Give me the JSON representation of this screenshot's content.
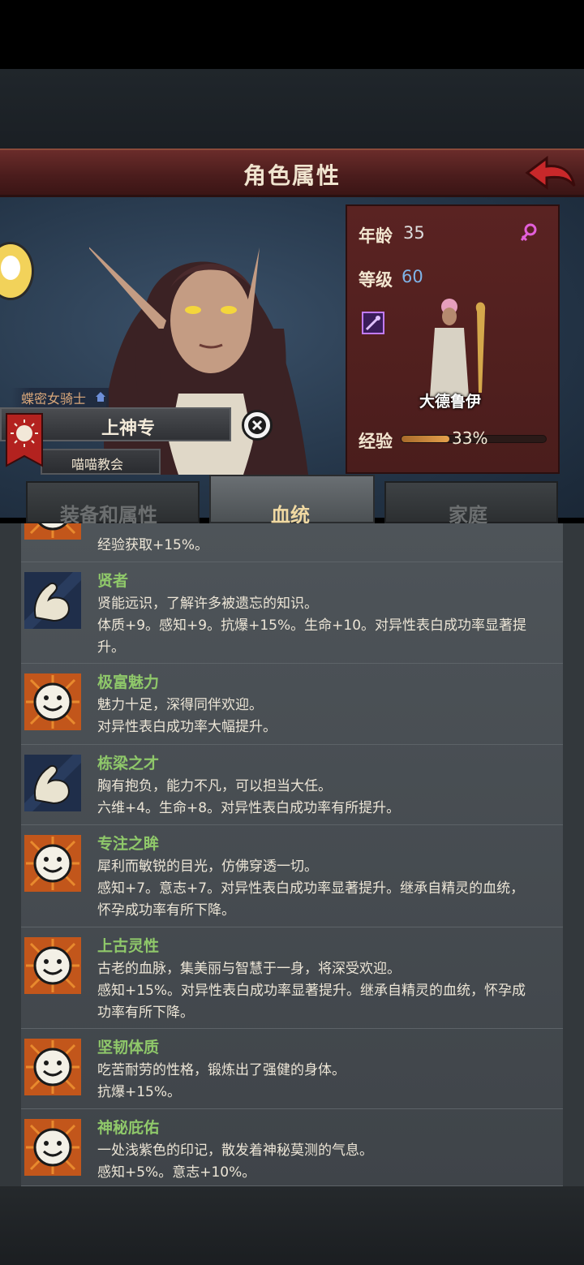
{
  "header": {
    "title": "角色属性"
  },
  "character": {
    "title": "蝶密女骑士",
    "name": "上神专",
    "church": "喵喵教会",
    "class_name": "大德鲁伊"
  },
  "stats": {
    "age_label": "年龄",
    "age_value": "35",
    "level_label": "等级",
    "level_value": "60",
    "exp_label": "经验",
    "exp_percent": "33%",
    "exp_fraction": 0.33
  },
  "tabs": [
    {
      "label": "装备和属性",
      "active": false
    },
    {
      "label": "血统",
      "active": true
    },
    {
      "label": "家庭",
      "active": false
    }
  ],
  "traits": [
    {
      "icon": "smile-icon",
      "name": "",
      "lines": [
        "经验获取+15%。"
      ]
    },
    {
      "icon": "muscle-arm-icon",
      "name": "贤者",
      "lines": [
        "贤能远识，了解许多被遗忘的知识。",
        "体质+9。感知+9。抗爆+15%。生命+10。对异性表白成功率显著提",
        "升。"
      ]
    },
    {
      "icon": "smile-icon",
      "name": "极富魅力",
      "lines": [
        "魅力十足，深得同伴欢迎。",
        "对异性表白成功率大幅提升。"
      ]
    },
    {
      "icon": "muscle-arm-icon",
      "name": "栋梁之才",
      "lines": [
        "胸有抱负，能力不凡，可以担当大任。",
        "六维+4。生命+8。对异性表白成功率有所提升。"
      ]
    },
    {
      "icon": "smile-icon",
      "name": "专注之眸",
      "lines": [
        "犀利而敏锐的目光，仿佛穿透一切。",
        "感知+7。意志+7。对异性表白成功率显著提升。继承自精灵的血统，",
        "怀孕成功率有所下降。"
      ]
    },
    {
      "icon": "smile-icon",
      "name": "上古灵性",
      "lines": [
        "古老的血脉，集美丽与智慧于一身，将深受欢迎。",
        "感知+15%。对异性表白成功率显著提升。继承自精灵的血统，怀孕成",
        "功率有所下降。"
      ]
    },
    {
      "icon": "smile-icon",
      "name": "坚韧体质",
      "lines": [
        "吃苦耐劳的性格，锻炼出了强健的身体。",
        "抗爆+15%。"
      ]
    },
    {
      "icon": "smile-icon",
      "name": "神秘庇佑",
      "lines": [
        "一处浅紫色的印记，散发着神秘莫测的气息。",
        "感知+5%。意志+10%。"
      ]
    }
  ]
}
